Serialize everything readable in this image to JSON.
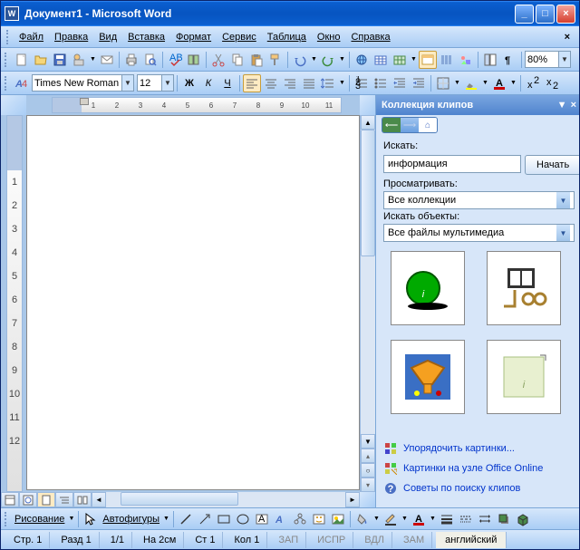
{
  "title": "Документ1 - Microsoft Word",
  "menus": [
    "Файл",
    "Правка",
    "Вид",
    "Вставка",
    "Формат",
    "Сервис",
    "Таблица",
    "Окно",
    "Справка"
  ],
  "formatting": {
    "style_width": "30",
    "font": "Times New Roman",
    "size": "12",
    "zoom": "80%"
  },
  "taskpane": {
    "title": "Коллекция клипов",
    "search_label": "Искать:",
    "search_value": "информация",
    "search_button": "Начать",
    "browse_label": "Просматривать:",
    "browse_value": "Все коллекции",
    "objects_label": "Искать объекты:",
    "objects_value": "Все файлы мультимедиа",
    "links": {
      "organize": "Упорядочить картинки...",
      "online": "Картинки на узле Office Online",
      "tips": "Советы по поиску клипов"
    }
  },
  "drawbar": {
    "drawing": "Рисование",
    "autoshapes": "Автофигуры"
  },
  "status": {
    "page": "Стр. 1",
    "section": "Разд 1",
    "pages": "1/1",
    "at": "На 2см",
    "line": "Ст 1",
    "col": "Кол 1",
    "rec": "ЗАП",
    "trk": "ИСПР",
    "ext": "ВДЛ",
    "ovr": "ЗАМ",
    "lang": "английский"
  }
}
